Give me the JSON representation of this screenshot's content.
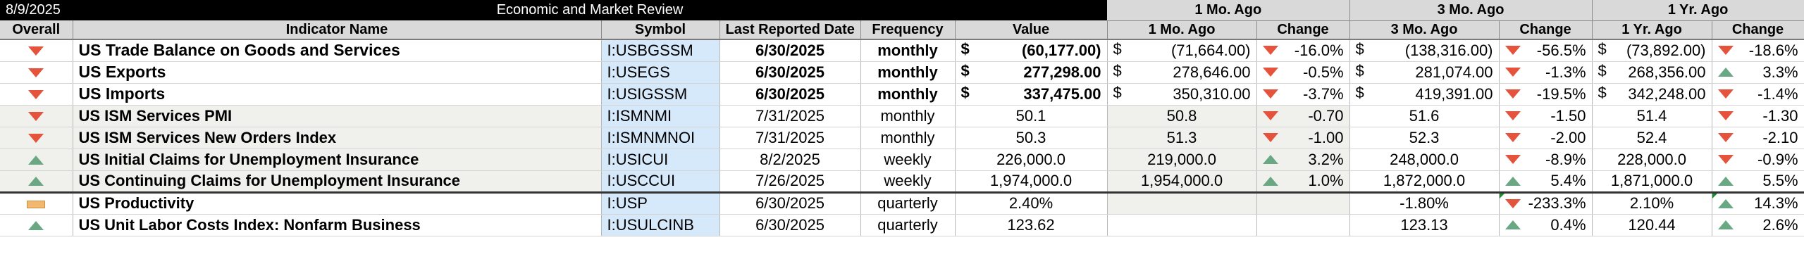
{
  "header": {
    "date": "8/9/2025",
    "title": "Economic and Market Review",
    "group_1mo": "1 Mo. Ago",
    "group_3mo": "3 Mo. Ago",
    "group_1yr": "1 Yr. Ago"
  },
  "columns": {
    "overall": "Overall",
    "name": "Indicator Name",
    "symbol": "Symbol",
    "date": "Last Reported Date",
    "frequency": "Frequency",
    "value": "Value",
    "mo1": "1 Mo. Ago",
    "mo1_change": "Change",
    "mo3": "3 Mo. Ago",
    "mo3_change": "Change",
    "yr1": "1 Yr. Ago",
    "yr1_change": "Change"
  },
  "rows": [
    {
      "overall": "down",
      "name": "US Trade Balance on Goods and Services",
      "symbol": "I:USBGSSM",
      "date": "6/30/2025",
      "frequency": "monthly",
      "value": "(60,177.00)",
      "mo1": "(71,664.00)",
      "mo1_dir": "down",
      "mo1_change": "-16.0%",
      "mo3": "(138,316.00)",
      "mo3_dir": "down",
      "mo3_change": "-56.5%",
      "yr1": "(73,892.00)",
      "yr1_dir": "down",
      "yr1_change": "-18.6%"
    },
    {
      "overall": "down",
      "name": "US Exports",
      "symbol": "I:USEGS",
      "date": "6/30/2025",
      "frequency": "monthly",
      "value": "277,298.00",
      "mo1": "278,646.00",
      "mo1_dir": "down",
      "mo1_change": "-0.5%",
      "mo3": "281,074.00",
      "mo3_dir": "down",
      "mo3_change": "-1.3%",
      "yr1": "268,356.00",
      "yr1_dir": "up",
      "yr1_change": "3.3%"
    },
    {
      "overall": "down",
      "name": "US Imports",
      "symbol": "I:USIGSSM",
      "date": "6/30/2025",
      "frequency": "monthly",
      "value": "337,475.00",
      "mo1": "350,310.00",
      "mo1_dir": "down",
      "mo1_change": "-3.7%",
      "mo3": "419,391.00",
      "mo3_dir": "down",
      "mo3_change": "-19.5%",
      "yr1": "342,248.00",
      "yr1_dir": "down",
      "yr1_change": "-1.4%"
    },
    {
      "overall": "down",
      "name": "US ISM Services PMI",
      "symbol": "I:ISMNMI",
      "date": "7/31/2025",
      "frequency": "monthly",
      "value": "50.1",
      "mo1": "50.8",
      "mo1_dir": "down",
      "mo1_change": "-0.70",
      "mo3": "51.6",
      "mo3_dir": "down",
      "mo3_change": "-1.50",
      "yr1": "51.4",
      "yr1_dir": "down",
      "yr1_change": "-1.30"
    },
    {
      "overall": "down",
      "name": "US ISM Services New Orders Index",
      "symbol": "I:ISMNMNOI",
      "date": "7/31/2025",
      "frequency": "monthly",
      "value": "50.3",
      "mo1": "51.3",
      "mo1_dir": "down",
      "mo1_change": "-1.00",
      "mo3": "52.3",
      "mo3_dir": "down",
      "mo3_change": "-2.00",
      "yr1": "52.4",
      "yr1_dir": "down",
      "yr1_change": "-2.10"
    },
    {
      "overall": "up",
      "name": "US Initial Claims for Unemployment Insurance",
      "symbol": "I:USICUI",
      "date": "8/2/2025",
      "frequency": "weekly",
      "value": "226,000.0",
      "mo1": "219,000.0",
      "mo1_dir": "up",
      "mo1_change": "3.2%",
      "mo3": "248,000.0",
      "mo3_dir": "down",
      "mo3_change": "-8.9%",
      "yr1": "228,000.0",
      "yr1_dir": "down",
      "yr1_change": "-0.9%"
    },
    {
      "overall": "up",
      "name": "US Continuing Claims for Unemployment Insurance",
      "symbol": "I:USCCUI",
      "date": "7/26/2025",
      "frequency": "weekly",
      "value": "1,974,000.0",
      "mo1": "1,954,000.0",
      "mo1_dir": "up",
      "mo1_change": "1.0%",
      "mo3": "1,872,000.0",
      "mo3_dir": "up",
      "mo3_change": "5.4%",
      "yr1": "1,871,000.0",
      "yr1_dir": "up",
      "yr1_change": "5.5%"
    },
    {
      "overall": "flat",
      "name": "US Productivity",
      "symbol": "I:USP",
      "date": "6/30/2025",
      "frequency": "quarterly",
      "value": "2.40%",
      "mo1": "",
      "mo1_dir": "",
      "mo1_change": "",
      "mo3": "-1.80%",
      "mo3_dir": "down",
      "mo3_change": "-233.3%",
      "yr1": "2.10%",
      "yr1_dir": "up",
      "yr1_change": "14.3%"
    },
    {
      "overall": "up",
      "name": "US Unit Labor Costs Index: Nonfarm Business",
      "symbol": "I:USULCINB",
      "date": "6/30/2025",
      "frequency": "quarterly",
      "value": "123.62",
      "mo1": "",
      "mo1_dir": "",
      "mo1_change": "",
      "mo3": "123.13",
      "mo3_dir": "up",
      "mo3_change": "0.4%",
      "yr1": "120.44",
      "yr1_dir": "up",
      "yr1_change": "2.6%"
    }
  ],
  "colors": {
    "down": "#e5533c",
    "up": "#6aa884",
    "flat": "#f2b872",
    "symbol_bg": "#d6e9fb",
    "header_bg": "#d9d9d9"
  },
  "currency_symbol": "$"
}
